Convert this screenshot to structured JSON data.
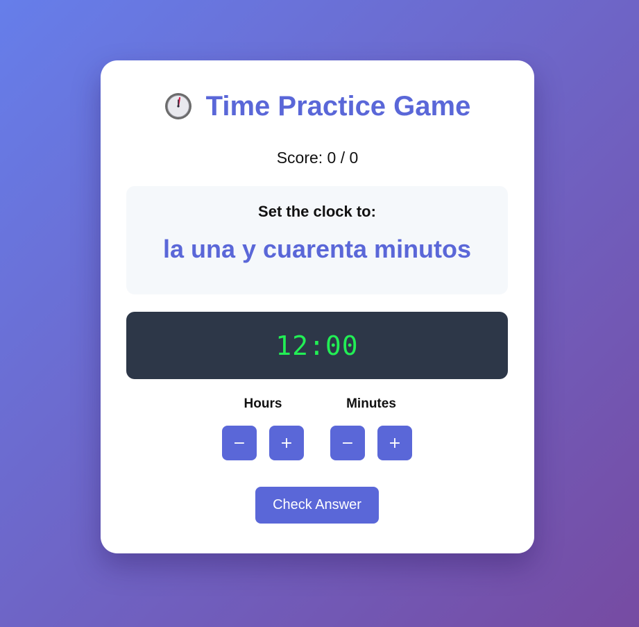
{
  "header": {
    "icon": "stopwatch-icon",
    "title": "Time Practice Game"
  },
  "score": {
    "text": "Score: 0 / 0"
  },
  "prompt": {
    "label": "Set the clock to:",
    "phrase": "la una y cuarenta minutos"
  },
  "display": {
    "time": "12:00"
  },
  "controls": {
    "hours": {
      "label": "Hours",
      "decrement": "−",
      "increment": "+"
    },
    "minutes": {
      "label": "Minutes",
      "decrement": "−",
      "increment": "+"
    }
  },
  "actions": {
    "check_label": "Check Answer"
  },
  "colors": {
    "accent": "#5a67d8",
    "display_bg": "#2d3748",
    "display_text": "#22ee55",
    "background_start": "#667eea",
    "background_end": "#764ba2"
  }
}
